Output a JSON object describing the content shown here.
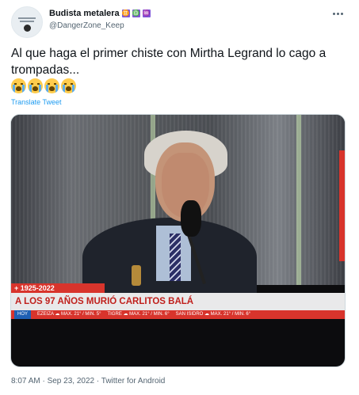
{
  "author": {
    "display_name": "Budista metalera",
    "name_emojis": [
      "♊",
      "♎",
      "♒"
    ],
    "handle": "@DangerZone_Keep"
  },
  "tweet": {
    "text": "Al que haga el primer chiste con Mirtha Legrand lo cago a trompadas...",
    "emojis": [
      "crying-face",
      "crying-face",
      "crying-face",
      "crying-face"
    ],
    "translate_label": "Translate Tweet"
  },
  "media": {
    "banner_dates": "+ 1925-2022",
    "headline": "A LOS 97 AÑOS MURIÓ CARLITOS BALÁ",
    "ticker": {
      "hoy": "HOY",
      "items": [
        "EZEIZA ☁ MAX. 21° / MIN. 5°",
        "TIGRE ☁ MAX. 21° / MIN. 6°",
        "SAN ISIDRO ☁ MAX. 21° / MIN. 6°"
      ]
    }
  },
  "meta": {
    "timestamp": "8:07 AM · Sep 23, 2022 · Twitter for Android"
  },
  "colors": {
    "link": "#1d9bf0",
    "banner_red": "#d8342c",
    "secondary_text": "#536471"
  }
}
